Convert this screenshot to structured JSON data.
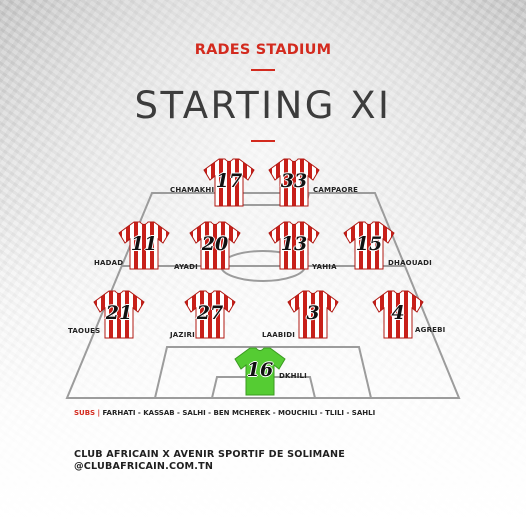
{
  "header": {
    "venue": "RADES STADIUM",
    "title": "STARTING XI"
  },
  "colors": {
    "accent": "#d32a1e",
    "shirt_red": "#c8201a",
    "shirt_white": "#ffffff",
    "goalkeeper_green": "#55cc33"
  },
  "players": [
    {
      "id": "chamakhi",
      "name": "CHAMAKHI",
      "number": "17"
    },
    {
      "id": "campaore",
      "name": "CAMPAORE",
      "number": "33"
    },
    {
      "id": "hadad",
      "name": "HADAD",
      "number": "11"
    },
    {
      "id": "ayadi",
      "name": "AYADI",
      "number": "20"
    },
    {
      "id": "yahia",
      "name": "YAHIA",
      "number": "13"
    },
    {
      "id": "dhaouadi",
      "name": "DHAOUADI",
      "number": "15"
    },
    {
      "id": "taoues",
      "name": "TAOUES",
      "number": "21"
    },
    {
      "id": "jaziri",
      "name": "JAZIRI",
      "number": "27"
    },
    {
      "id": "laabidi",
      "name": "LAABIDI",
      "number": "3"
    },
    {
      "id": "agrebi",
      "name": "AGREBI",
      "number": "4"
    },
    {
      "id": "dkhili",
      "name": "DKHILI",
      "number": "16"
    }
  ],
  "subs": {
    "label": "SUBS |",
    "list": "FARHATI - KASSAB - SALHI - BEN MCHEREK  -  MOUCHILI - TLILI - SAHLI"
  },
  "footer": {
    "matchup": "CLUB AFRICAIN X AVENIR SPORTIF DE SOLIMANE",
    "website": "@CLUBAFRICAIN.COM.TN"
  }
}
